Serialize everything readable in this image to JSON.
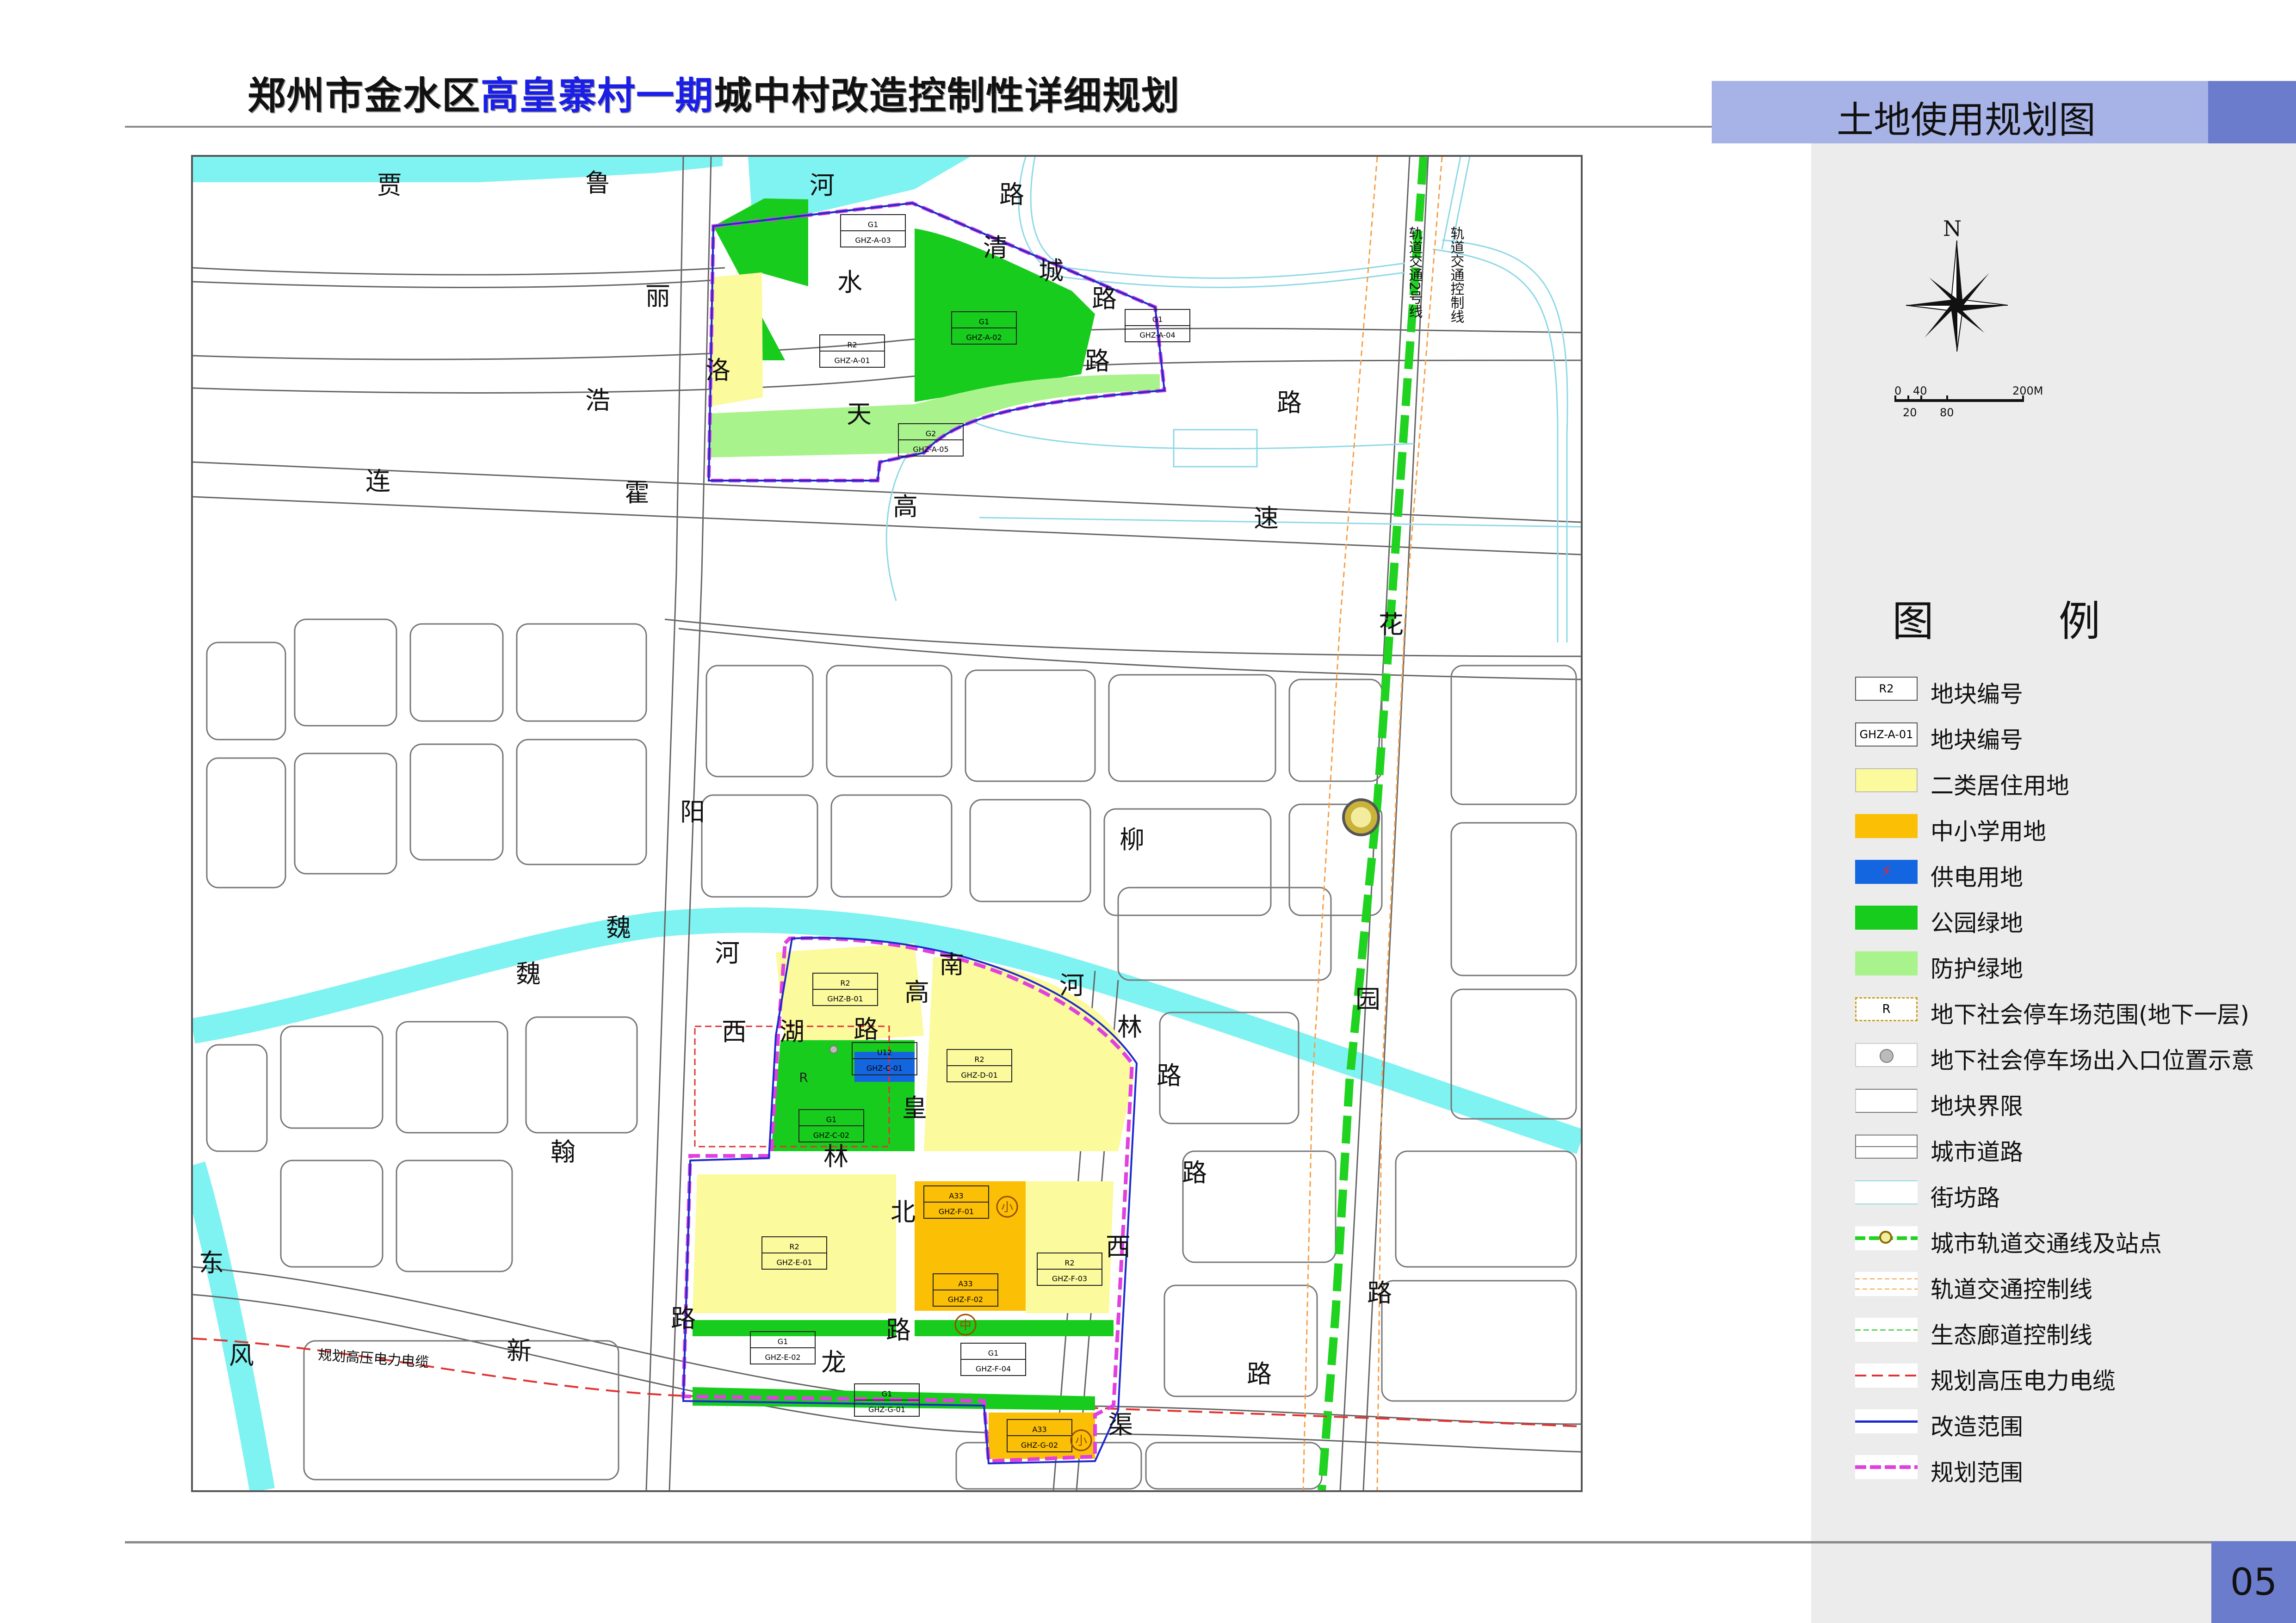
{
  "header": {
    "title_part1": "郑州市金水区",
    "title_highlight": "高皇寨村一期",
    "title_part2": "城中村改造控制性详细规划",
    "banner_title": "土地使用规划图",
    "page_number": "05"
  },
  "map": {
    "road_labels": [
      {
        "id": "jia",
        "text": "贾"
      },
      {
        "id": "lu1",
        "text": "鲁"
      },
      {
        "id": "he1",
        "text": "河"
      },
      {
        "id": "lu2",
        "text": "路"
      },
      {
        "id": "qing",
        "text": "清"
      },
      {
        "id": "cheng",
        "text": "城"
      },
      {
        "id": "lu3",
        "text": "路"
      },
      {
        "id": "shui",
        "text": "水"
      },
      {
        "id": "li",
        "text": "丽"
      },
      {
        "id": "luo",
        "text": "洛"
      },
      {
        "id": "lu4",
        "text": "路"
      },
      {
        "id": "hao",
        "text": "浩"
      },
      {
        "id": "tian",
        "text": "天"
      },
      {
        "id": "lu5",
        "text": "路"
      },
      {
        "id": "lian",
        "text": "连"
      },
      {
        "id": "huo",
        "text": "霍"
      },
      {
        "id": "gao1",
        "text": "高"
      },
      {
        "id": "su",
        "text": "速"
      },
      {
        "id": "hua",
        "text": "花"
      },
      {
        "id": "yang",
        "text": "阳"
      },
      {
        "id": "liu",
        "text": "柳"
      },
      {
        "id": "wei1",
        "text": "魏"
      },
      {
        "id": "wei2",
        "text": "魏"
      },
      {
        "id": "he2",
        "text": "河"
      },
      {
        "id": "nan",
        "text": "南"
      },
      {
        "id": "he3",
        "text": "河"
      },
      {
        "id": "gao2",
        "text": "高"
      },
      {
        "id": "xi1",
        "text": "西"
      },
      {
        "id": "hu",
        "text": "湖"
      },
      {
        "id": "lu6",
        "text": "路"
      },
      {
        "id": "lin1",
        "text": "林"
      },
      {
        "id": "yuan",
        "text": "园"
      },
      {
        "id": "lu7",
        "text": "路"
      },
      {
        "id": "huang",
        "text": "皇"
      },
      {
        "id": "han",
        "text": "翰"
      },
      {
        "id": "lin2",
        "text": "林"
      },
      {
        "id": "bei",
        "text": "北"
      },
      {
        "id": "lu8",
        "text": "路"
      },
      {
        "id": "xi2",
        "text": "西"
      },
      {
        "id": "dong",
        "text": "东"
      },
      {
        "id": "lu9",
        "text": "路"
      },
      {
        "id": "lu10",
        "text": "路"
      },
      {
        "id": "feng",
        "text": "风"
      },
      {
        "id": "xin",
        "text": "新"
      },
      {
        "id": "long",
        "text": "龙"
      },
      {
        "id": "lu11",
        "text": "路"
      },
      {
        "id": "lu12",
        "text": "路"
      },
      {
        "id": "qu",
        "text": "渠"
      }
    ],
    "rail_line_label": "轨道交通2号线",
    "rail_control_label": "轨道交通控制线",
    "power_cable_label": "规划高压电力电缆",
    "parcels": [
      {
        "code": "G1",
        "id": "GHZ-A-03",
        "use": "park"
      },
      {
        "code": "R2",
        "id": "GHZ-A-01",
        "use": "residential"
      },
      {
        "code": "G1",
        "id": "GHZ-A-02",
        "use": "park"
      },
      {
        "code": "G1",
        "id": "GHZ-A-04",
        "use": "park"
      },
      {
        "code": "G2",
        "id": "GHZ-A-05",
        "use": "buffer"
      },
      {
        "code": "R2",
        "id": "GHZ-B-01",
        "use": "residential"
      },
      {
        "code": "U12",
        "id": "GHZ-C-01",
        "use": "power"
      },
      {
        "code": "G1",
        "id": "GHZ-C-02",
        "use": "park"
      },
      {
        "code": "R2",
        "id": "GHZ-D-01",
        "use": "residential"
      },
      {
        "code": "R2",
        "id": "GHZ-E-01",
        "use": "residential"
      },
      {
        "code": "G1",
        "id": "GHZ-E-02",
        "use": "park"
      },
      {
        "code": "A33",
        "id": "GHZ-F-01",
        "use": "school"
      },
      {
        "code": "A33",
        "id": "GHZ-F-02",
        "use": "school"
      },
      {
        "code": "R2",
        "id": "GHZ-F-03",
        "use": "residential"
      },
      {
        "code": "G1",
        "id": "GHZ-F-04",
        "use": "park"
      },
      {
        "code": "G1",
        "id": "GHZ-G-01",
        "use": "park"
      },
      {
        "code": "A33",
        "id": "GHZ-G-02",
        "use": "school"
      }
    ],
    "markers": {
      "parking_symbol": "R",
      "small_school": "小",
      "middle_school": "中"
    }
  },
  "compass": {
    "north_label": "N"
  },
  "scale": {
    "top_labels": [
      "0",
      "40",
      "200M"
    ],
    "bottom_labels": [
      "20",
      "80"
    ]
  },
  "legend": {
    "title": "图　例",
    "items": [
      {
        "sample": "R2",
        "label": "地块编号",
        "type": "code-box"
      },
      {
        "sample": "GHZ-A-01",
        "label": "地块编号",
        "type": "code-box"
      },
      {
        "label": "二类居住用地",
        "type": "fill",
        "color": "#fbfa9c"
      },
      {
        "label": "中小学用地",
        "type": "fill",
        "color": "#fbbf05"
      },
      {
        "label": "供电用地",
        "type": "power",
        "color": "#1466e0"
      },
      {
        "label": "公园绿地",
        "type": "fill",
        "color": "#18cc1d"
      },
      {
        "label": "防护绿地",
        "type": "fill",
        "color": "#a8f38c"
      },
      {
        "sample": "R",
        "label": "地下社会停车场范围(地下一层)",
        "type": "parking-range"
      },
      {
        "label": "地下社会停车场出入口位置示意",
        "type": "parking-entry"
      },
      {
        "label": "地块界限",
        "type": "parcel-line"
      },
      {
        "label": "城市道路",
        "type": "city-road"
      },
      {
        "label": "街坊路",
        "type": "block-road"
      },
      {
        "label": "城市轨道交通线及站点",
        "type": "rail"
      },
      {
        "label": "轨道交通控制线",
        "type": "rail-control"
      },
      {
        "label": "生态廊道控制线",
        "type": "eco-line"
      },
      {
        "label": "规划高压电力电缆",
        "type": "power-cable"
      },
      {
        "label": "改造范围",
        "type": "reform-range"
      },
      {
        "label": "规划范围",
        "type": "plan-range"
      }
    ]
  },
  "colors": {
    "residential": "#fbfa9c",
    "school": "#fbbf05",
    "power": "#1466e0",
    "park": "#18cc1d",
    "buffer": "#a8f38c",
    "river": "#7ff2f2",
    "rail": "#21d321",
    "reform_range": "#1e2bcc",
    "plan_range": "#e040e0",
    "banner": "#a7b2e6",
    "banner_dark": "#6c7ccc"
  }
}
